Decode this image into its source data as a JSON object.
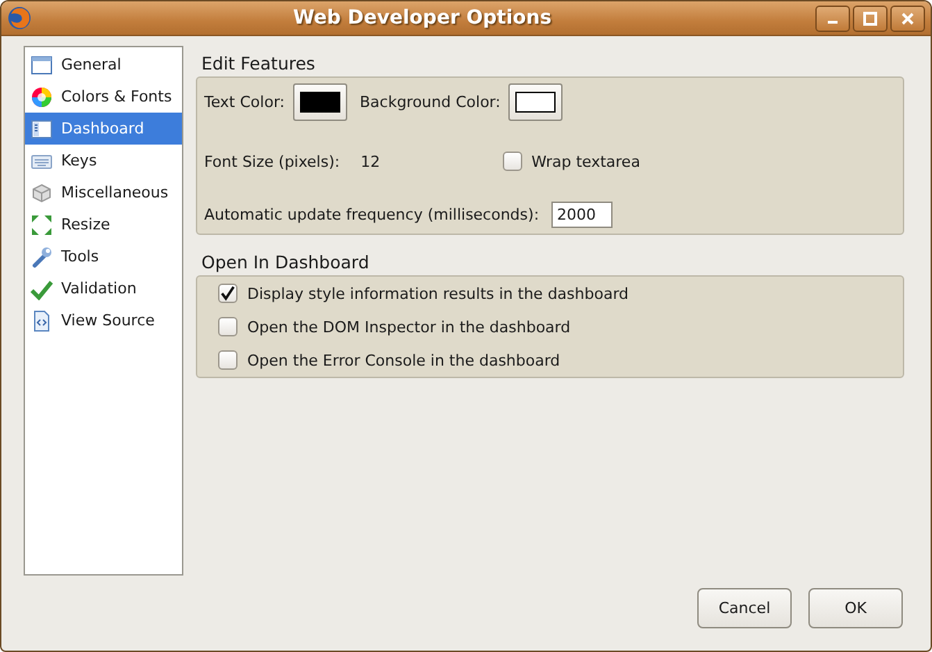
{
  "window": {
    "title": "Web Developer Options"
  },
  "sidebar": {
    "items": [
      {
        "label": "General",
        "selected": false
      },
      {
        "label": "Colors & Fonts",
        "selected": false
      },
      {
        "label": "Dashboard",
        "selected": true
      },
      {
        "label": "Keys",
        "selected": false
      },
      {
        "label": "Miscellaneous",
        "selected": false
      },
      {
        "label": "Resize",
        "selected": false
      },
      {
        "label": "Tools",
        "selected": false
      },
      {
        "label": "Validation",
        "selected": false
      },
      {
        "label": "View Source",
        "selected": false
      }
    ]
  },
  "edit_features": {
    "title": "Edit Features",
    "text_color": {
      "label": "Text Color:",
      "color": "#000000"
    },
    "background_color": {
      "label": "Background Color:",
      "color": "#ffffff"
    },
    "font_size": {
      "label": "Font Size (pixels):",
      "value": "12"
    },
    "wrap_textarea": {
      "label": "Wrap textarea",
      "checked": false
    },
    "update_frequency": {
      "label": "Automatic update frequency (milliseconds):",
      "value": "2000"
    }
  },
  "open_in_dashboard": {
    "title": "Open In Dashboard",
    "options": [
      {
        "label": "Display style information results in the dashboard",
        "checked": true
      },
      {
        "label": "Open the DOM Inspector in the dashboard",
        "checked": false
      },
      {
        "label": "Open the Error Console in the dashboard",
        "checked": false
      }
    ]
  },
  "buttons": [
    "Cancel",
    "OK"
  ]
}
